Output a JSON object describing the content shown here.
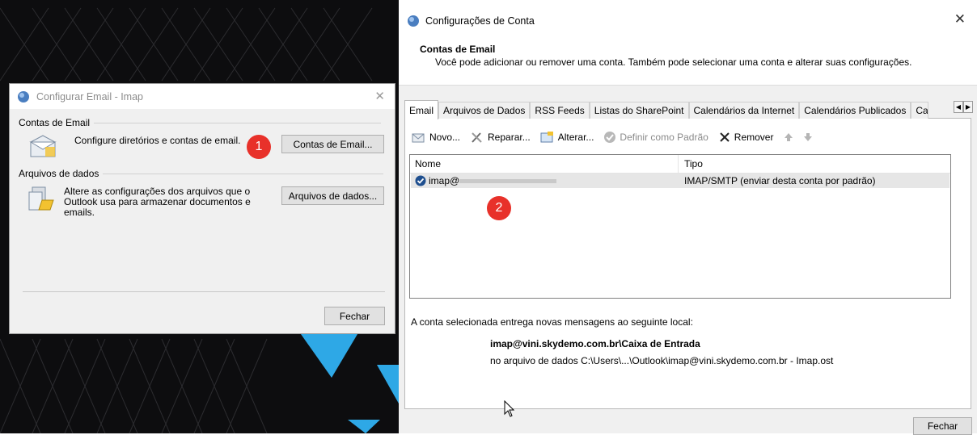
{
  "dialog_email": {
    "title": "Configurar Email - Imap",
    "group_accounts": "Contas de Email",
    "accounts_text": "Configure diretórios e contas de email.",
    "accounts_button": "Contas de Email...",
    "group_datafiles": "Arquivos de dados",
    "datafiles_text_1": "Altere as configurações dos arquivos que o",
    "datafiles_text_2": "Outlook usa para armazenar documentos e",
    "datafiles_text_3": "emails.",
    "datafiles_button": "Arquivos de dados...",
    "close_button": "Fechar"
  },
  "badges": {
    "one": "1",
    "two": "2"
  },
  "account_settings": {
    "title": "Configurações de Conta",
    "header_title": "Contas de Email",
    "header_subtitle": "Você pode adicionar ou remover uma conta. Também pode selecionar uma conta e alterar suas configurações.",
    "tabs": [
      "Email",
      "Arquivos de Dados",
      "RSS Feeds",
      "Listas do SharePoint",
      "Calendários da Internet",
      "Calendários Publicados",
      "Ca"
    ],
    "toolbar": {
      "new": "Novo...",
      "repair": "Reparar...",
      "change": "Alterar...",
      "set_default": "Definir como Padrão",
      "remove": "Remover"
    },
    "list": {
      "col_name": "Nome",
      "col_type": "Tipo",
      "rows": [
        {
          "name": "imap@",
          "type": "IMAP/SMTP (enviar desta conta por padrão)"
        }
      ]
    },
    "delivery_label": "A conta selecionada entrega novas mensagens ao seguinte local:",
    "delivery_location": "imap@vini.skydemo.com.br\\Caixa de Entrada",
    "delivery_file": "no arquivo de dados C:\\Users\\...\\Outlook\\imap@vini.skydemo.com.br - Imap.ost",
    "close_button": "Fechar"
  },
  "colors": {
    "badge": "#e8312a",
    "desktop_bg": "#0d0d0f",
    "accent_triangle": "#2ea8e6"
  }
}
